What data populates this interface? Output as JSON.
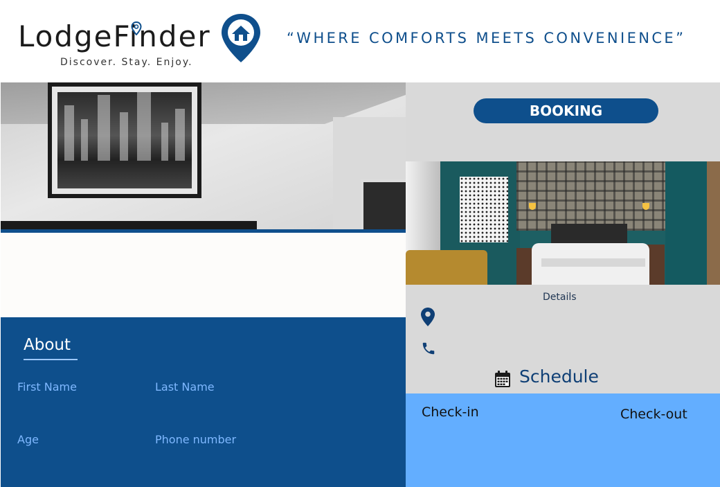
{
  "brand": {
    "name": "LodgeFinder",
    "subtitle": "Discover. Stay. Enjoy.",
    "tagline": "“WHERE COMFORTS MEETS CONVENIENCE”",
    "color": "#0f4f8c"
  },
  "booking": {
    "button_label": "BOOKING"
  },
  "details": {
    "label": "Details",
    "location_icon": "map-pin-icon",
    "phone_icon": "phone-icon"
  },
  "schedule": {
    "icon": "calendar-icon",
    "title": "Schedule",
    "checkin_label": "Check-in",
    "checkout_label": "Check-out"
  },
  "about": {
    "title": "About",
    "fields": {
      "first_name": "First Name",
      "last_name": "Last Name",
      "age": "Age",
      "phone": "Phone number"
    }
  },
  "colors": {
    "primary": "#0e4f8c",
    "light_blue": "#63aeff",
    "gray_panel": "#d9d9d9",
    "field_label": "#7fb8ff"
  }
}
